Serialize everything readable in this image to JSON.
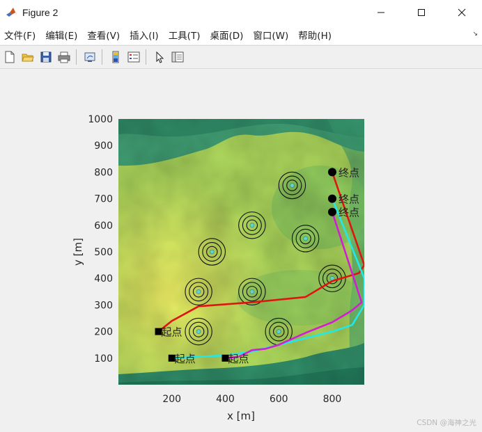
{
  "window": {
    "title": "Figure 2"
  },
  "menu": [
    "文件(F)",
    "编辑(E)",
    "查看(V)",
    "插入(I)",
    "工具(T)",
    "桌面(D)",
    "窗口(W)",
    "帮助(H)"
  ],
  "toolbar": [
    "new-figure-icon",
    "open-file-icon",
    "save-icon",
    "print-icon",
    "link-plot-icon",
    "colorbar-icon",
    "legend-icon",
    "edit-plot-arrow-icon",
    "property-inspector-icon"
  ],
  "chart_data": {
    "type": "line",
    "title": "",
    "xlabel": "x [m]",
    "ylabel": "y [m]",
    "xlim": [
      0,
      920
    ],
    "ylim": [
      0,
      1000
    ],
    "xticks": [
      200,
      400,
      600,
      800
    ],
    "yticks": [
      100,
      200,
      300,
      400,
      500,
      600,
      700,
      800,
      900,
      1000
    ],
    "grid": false,
    "background": "terrain elevation map (green-yellow colormap)",
    "obstacles": [
      {
        "x": 300,
        "y": 200
      },
      {
        "x": 600,
        "y": 200
      },
      {
        "x": 300,
        "y": 350
      },
      {
        "x": 500,
        "y": 350
      },
      {
        "x": 350,
        "y": 500
      },
      {
        "x": 500,
        "y": 600
      },
      {
        "x": 700,
        "y": 550
      },
      {
        "x": 650,
        "y": 750
      },
      {
        "x": 800,
        "y": 400
      }
    ],
    "start_label": "起点",
    "end_label": "终点",
    "series": [
      {
        "color": "#e0150f",
        "x": [
          150,
          200,
          300,
          500,
          700,
          750,
          800,
          900,
          920,
          800
        ],
        "y": [
          200,
          240,
          295,
          310,
          330,
          360,
          390,
          420,
          450,
          800
        ],
        "start": {
          "x": 150,
          "y": 200
        },
        "end": {
          "x": 800,
          "y": 800
        }
      },
      {
        "color": "#22e8ea",
        "x": [
          200,
          300,
          400,
          500,
          600,
          700,
          800,
          875,
          920,
          920,
          800
        ],
        "y": [
          100,
          105,
          110,
          125,
          150,
          175,
          200,
          225,
          300,
          400,
          700
        ],
        "start": {
          "x": 200,
          "y": 100
        },
        "end": {
          "x": 800,
          "y": 700
        }
      },
      {
        "color": "#d21ed2",
        "x": [
          400,
          450,
          500,
          550,
          600,
          700,
          800,
          875,
          910,
          800
        ],
        "y": [
          100,
          105,
          130,
          135,
          150,
          195,
          235,
          280,
          310,
          650
        ],
        "start": {
          "x": 400,
          "y": 100
        },
        "end": {
          "x": 800,
          "y": 650
        }
      }
    ]
  },
  "watermark": "CSDN @海神之光"
}
